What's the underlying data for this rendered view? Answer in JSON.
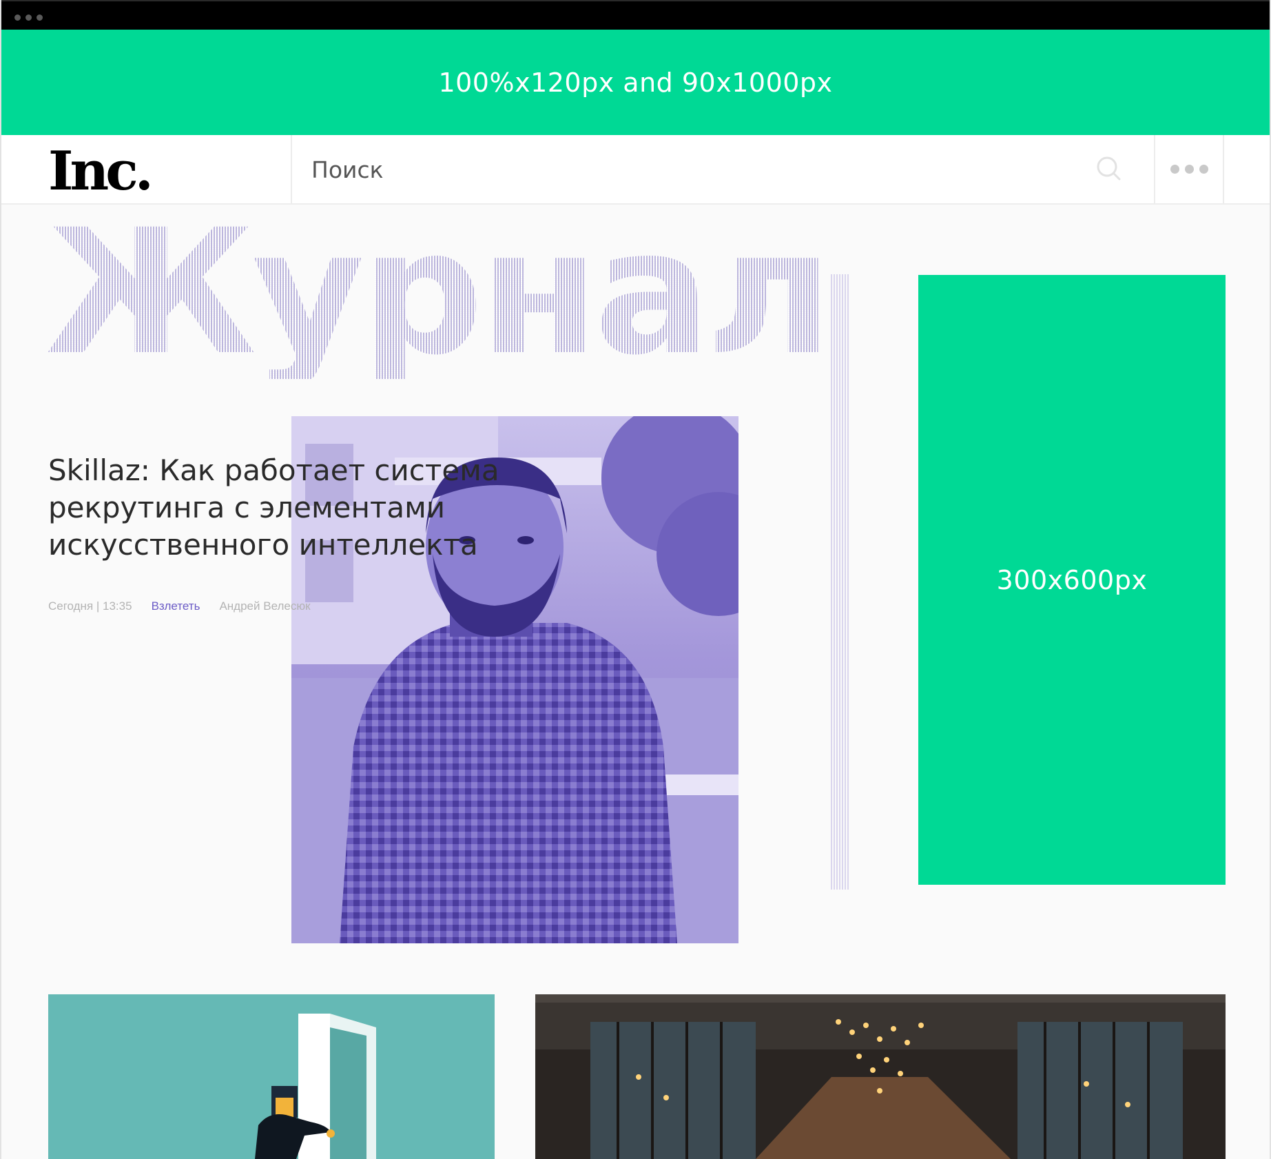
{
  "top_banner": {
    "label": "100%x120px and 90x1000px"
  },
  "header": {
    "logo": "Inc.",
    "search": {
      "placeholder": "Поиск"
    },
    "icons": [
      "search-icon",
      "more-icon"
    ]
  },
  "hero": {
    "section_title": "Журнал",
    "headline": "Skillaz: Как работает система рекрутинга с элементами искусственного интеллекта",
    "meta": {
      "date": "Сегодня | 13:35",
      "tag": "Взлететь",
      "author": "Андрей Велесюк"
    }
  },
  "side_banner": {
    "label": "300x600px"
  },
  "colors": {
    "accent_green": "#00d995",
    "accent_purple": "#6b5bc6",
    "photo_tint": "#8a7dcc"
  }
}
